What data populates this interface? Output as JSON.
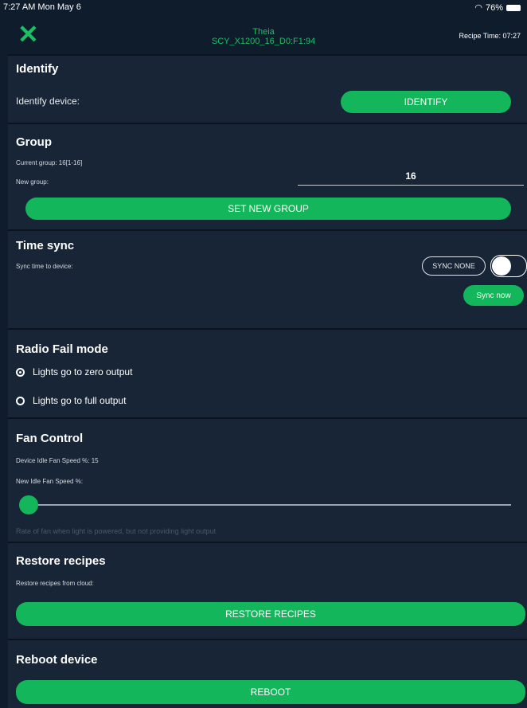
{
  "status": {
    "time_date": "7:27 AM  Mon May 6",
    "battery": "76%"
  },
  "header": {
    "title": "Theia",
    "subtitle": "SCY_X1200_16_D0:F1:94",
    "recipe_time": "Recipe Time: 07:27"
  },
  "identify": {
    "title": "Identify",
    "label": "Identify device:",
    "button": "IDENTIFY"
  },
  "group": {
    "title": "Group",
    "current": "Current group: 16[1-16]",
    "new_label": "New group:",
    "new_value": "16",
    "button": "SET NEW GROUP"
  },
  "timesync": {
    "title": "Time sync",
    "label": "Sync time to device:",
    "chip": "SYNC NONE",
    "button": "Sync now"
  },
  "radiofail": {
    "title": "Radio Fail mode",
    "options": [
      "Lights go to zero output",
      "Lights go to full output"
    ],
    "selected_index": 0
  },
  "fan": {
    "title": "Fan Control",
    "idle": "Device Idle Fan Speed %: 15",
    "new_label": "New Idle Fan Speed %:",
    "hint": "Rate of fan when light is powered, but not providing light output",
    "slider_level": 0
  },
  "restore": {
    "title": "Restore recipes",
    "label": "Restore recipes from cloud:",
    "button": "RESTORE RECIPES"
  },
  "reboot": {
    "title": "Reboot device",
    "button": "REBOOT"
  },
  "colors": {
    "accent": "#13b65a",
    "background": "#0f1c2b",
    "section": "#172536"
  }
}
